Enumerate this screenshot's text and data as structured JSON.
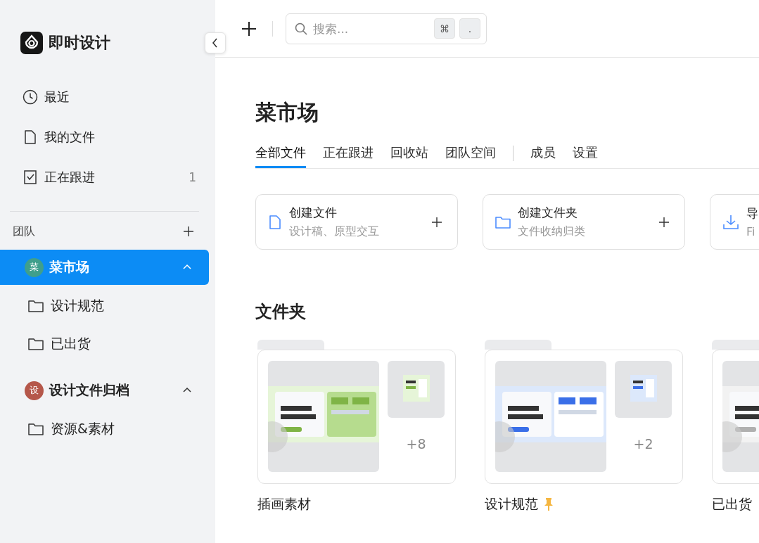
{
  "brand": {
    "name": "即时设计"
  },
  "nav": [
    {
      "kind": "recent",
      "label": "最近",
      "selected": false
    },
    {
      "kind": "files",
      "label": "我的文件",
      "selected": false
    },
    {
      "kind": "following",
      "label": "正在跟进",
      "count": "1",
      "selected": false
    }
  ],
  "teams_header": {
    "label": "团队"
  },
  "teams": [
    {
      "name": "菜市场",
      "avatar": "菜",
      "color": "#3f9f8c",
      "selected": true,
      "expanded": true,
      "children": [
        {
          "label": "设计规范"
        },
        {
          "label": "已出货"
        }
      ]
    },
    {
      "name": "设计文件归档",
      "avatar": "设",
      "color": "#b5574a",
      "selected": false,
      "expanded": true,
      "children": [
        {
          "label": "资源&素材"
        }
      ]
    }
  ],
  "toolbar": {
    "search": {
      "placeholder": "搜索...",
      "keys": [
        "⌘",
        "."
      ]
    }
  },
  "project": {
    "title": "菜市场",
    "tabs": [
      {
        "label": "全部文件",
        "selected": true
      },
      {
        "label": "正在跟进",
        "selected": false
      },
      {
        "label": "回收站",
        "selected": false
      },
      {
        "label": "团队空间",
        "selected": false
      }
    ],
    "admin_tabs": [
      {
        "label": "成员",
        "selected": false
      },
      {
        "label": "设置",
        "selected": false
      }
    ],
    "actions": [
      {
        "kind": "file",
        "title": "创建文件",
        "subtitle": "设计稿、原型交互"
      },
      {
        "kind": "folder",
        "title": "创建文件夹",
        "subtitle": "文件收纳归类"
      },
      {
        "kind": "import",
        "title": "导",
        "subtitle": "Fi"
      }
    ],
    "folders_heading": "文件夹",
    "folders": [
      {
        "name": "插画素材",
        "more": "+8",
        "pinned": false
      },
      {
        "name": "设计规范",
        "more": "+2",
        "pinned": true
      },
      {
        "name": "已出货"
      }
    ]
  }
}
